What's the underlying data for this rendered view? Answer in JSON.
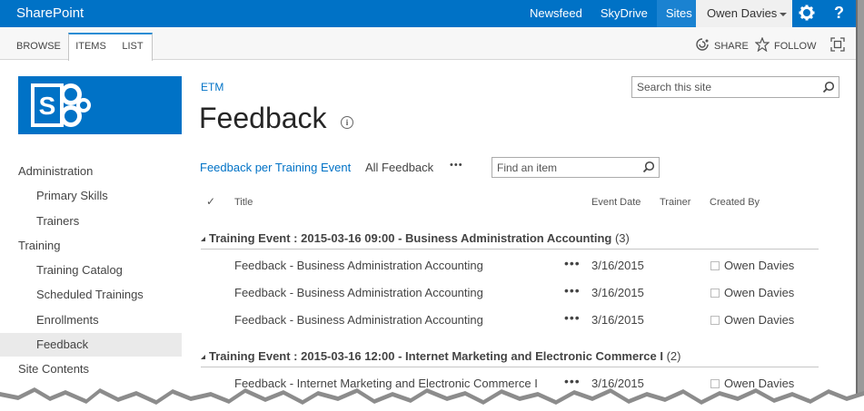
{
  "suitebar": {
    "brand": "SharePoint",
    "links": [
      "Newsfeed",
      "SkyDrive",
      "Sites"
    ],
    "user": "Owen Davies",
    "settings_icon": "gear-icon",
    "help_label": "?"
  },
  "ribbon": {
    "tabs": [
      "BROWSE",
      "ITEMS",
      "LIST"
    ],
    "share_label": "SHARE",
    "follow_label": "FOLLOW",
    "focus_icon": "focus-on-content-icon"
  },
  "site": {
    "search_placeholder": "Search this site"
  },
  "nav": {
    "items": [
      "Administration",
      "Primary Skills",
      "Trainers",
      "Training",
      "Training Catalog",
      "Scheduled Trainings",
      "Enrollments",
      "Feedback",
      "Site Contents"
    ],
    "selected": "Feedback"
  },
  "page": {
    "breadcrumb": "ETM",
    "title": "Feedback",
    "info_icon": "info-icon"
  },
  "views": {
    "view1": "Feedback per Training Event",
    "view2": "All Feedback",
    "more": "•••",
    "find_placeholder": "Find an item"
  },
  "columns": {
    "check": "✓",
    "title": "Title",
    "event_date": "Event Date",
    "trainer": "Trainer",
    "created_by": "Created By"
  },
  "groups": [
    {
      "label": "Training Event : 2015-03-16 09:00",
      "sep": " - ",
      "name": "Business Administration Accounting",
      "count": "(3)",
      "rows": [
        {
          "title": "Feedback - Business Administration Accounting",
          "date": "3/16/2015",
          "by": "Owen Davies"
        },
        {
          "title": "Feedback - Business Administration Accounting",
          "date": "3/16/2015",
          "by": "Owen Davies"
        },
        {
          "title": "Feedback - Business Administration Accounting",
          "date": "3/16/2015",
          "by": "Owen Davies"
        }
      ]
    },
    {
      "label": "Training Event : 2015-03-16 12:00",
      "sep": " - ",
      "name": "Internet Marketing and Electronic Commerce I",
      "count": "(2)",
      "rows": [
        {
          "title": "Feedback - Internet Marketing and Electronic Commerce I",
          "date": "3/16/2015",
          "by": "Owen Davies"
        }
      ]
    }
  ],
  "row_more": "•••",
  "colors": {
    "suitebar": "#0072c6",
    "link": "#0072c6",
    "nav_selected": "#eaeaea"
  }
}
